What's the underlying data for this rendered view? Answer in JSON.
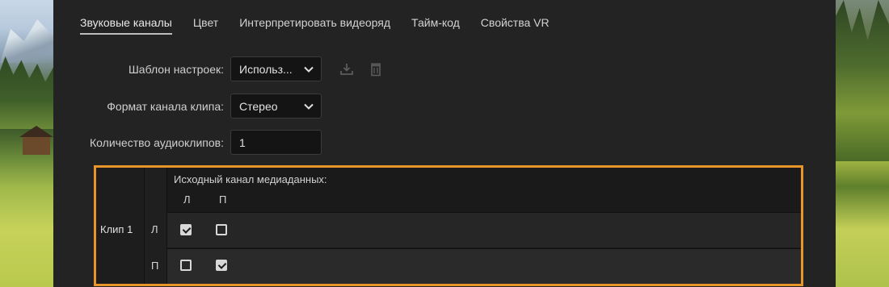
{
  "tabs": [
    {
      "label": "Звуковые каналы",
      "active": true
    },
    {
      "label": "Цвет"
    },
    {
      "label": "Интерпретировать видеоряд"
    },
    {
      "label": "Тайм-код"
    },
    {
      "label": "Свойства VR"
    }
  ],
  "preset": {
    "label": "Шаблон настроек:",
    "value": "Использ..."
  },
  "clip_format": {
    "label": "Формат канала клипа:",
    "value": "Стерео"
  },
  "audio_clips": {
    "label": "Количество аудиоклипов:",
    "value": "1"
  },
  "matrix": {
    "title": "Исходный канал медиаданных:",
    "columns": [
      "Л",
      "П"
    ],
    "clip_label": "Клип 1",
    "rows": [
      {
        "channel": "Л",
        "checks": [
          true,
          false
        ]
      },
      {
        "channel": "П",
        "checks": [
          false,
          true
        ]
      }
    ],
    "highlight_color": "#e8952b"
  },
  "icons": {
    "save": "download-icon",
    "delete": "trash-icon",
    "dropdown": "chevron-down-icon"
  }
}
